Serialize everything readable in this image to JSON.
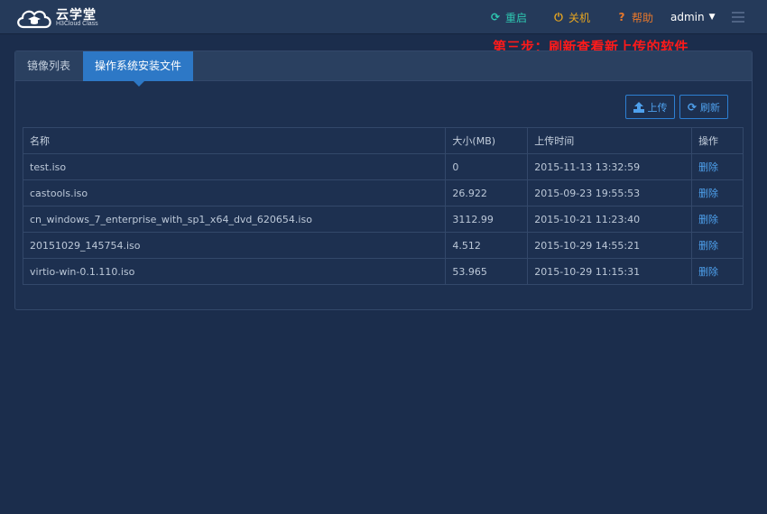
{
  "header": {
    "logo_title": "云学堂",
    "logo_subtitle": "H3Cloud Class",
    "nav": {
      "restart": "重启",
      "shutdown": "关机",
      "help": "帮助",
      "user": "admin"
    },
    "colors": {
      "restart": "#2ec6b0",
      "shutdown": "#e6a520",
      "help": "#e8782b"
    }
  },
  "annotation": {
    "text": "第三步：刷新查看新上传的软件",
    "color": "#ff1a1a"
  },
  "tabs": [
    {
      "label": "镜像列表",
      "active": false
    },
    {
      "label": "操作系统安装文件",
      "active": true
    }
  ],
  "toolbar": {
    "upload_label": "上传",
    "refresh_label": "刷新"
  },
  "table": {
    "headers": [
      "名称",
      "大小(MB)",
      "上传时间",
      "操作"
    ],
    "rows": [
      {
        "name": "test.iso",
        "size": "0",
        "time": "2015-11-13 13:32:59",
        "action": "删除"
      },
      {
        "name": "castools.iso",
        "size": "26.922",
        "time": "2015-09-23 19:55:53",
        "action": "删除"
      },
      {
        "name": "cn_windows_7_enterprise_with_sp1_x64_dvd_620654.iso",
        "size": "3112.99",
        "time": "2015-10-21 11:23:40",
        "action": "删除"
      },
      {
        "name": "20151029_145754.iso",
        "size": "4.512",
        "time": "2015-10-29 14:55:21",
        "action": "删除"
      },
      {
        "name": "virtio-win-0.1.110.iso",
        "size": "53.965",
        "time": "2015-10-29 11:15:31",
        "action": "删除"
      }
    ]
  }
}
